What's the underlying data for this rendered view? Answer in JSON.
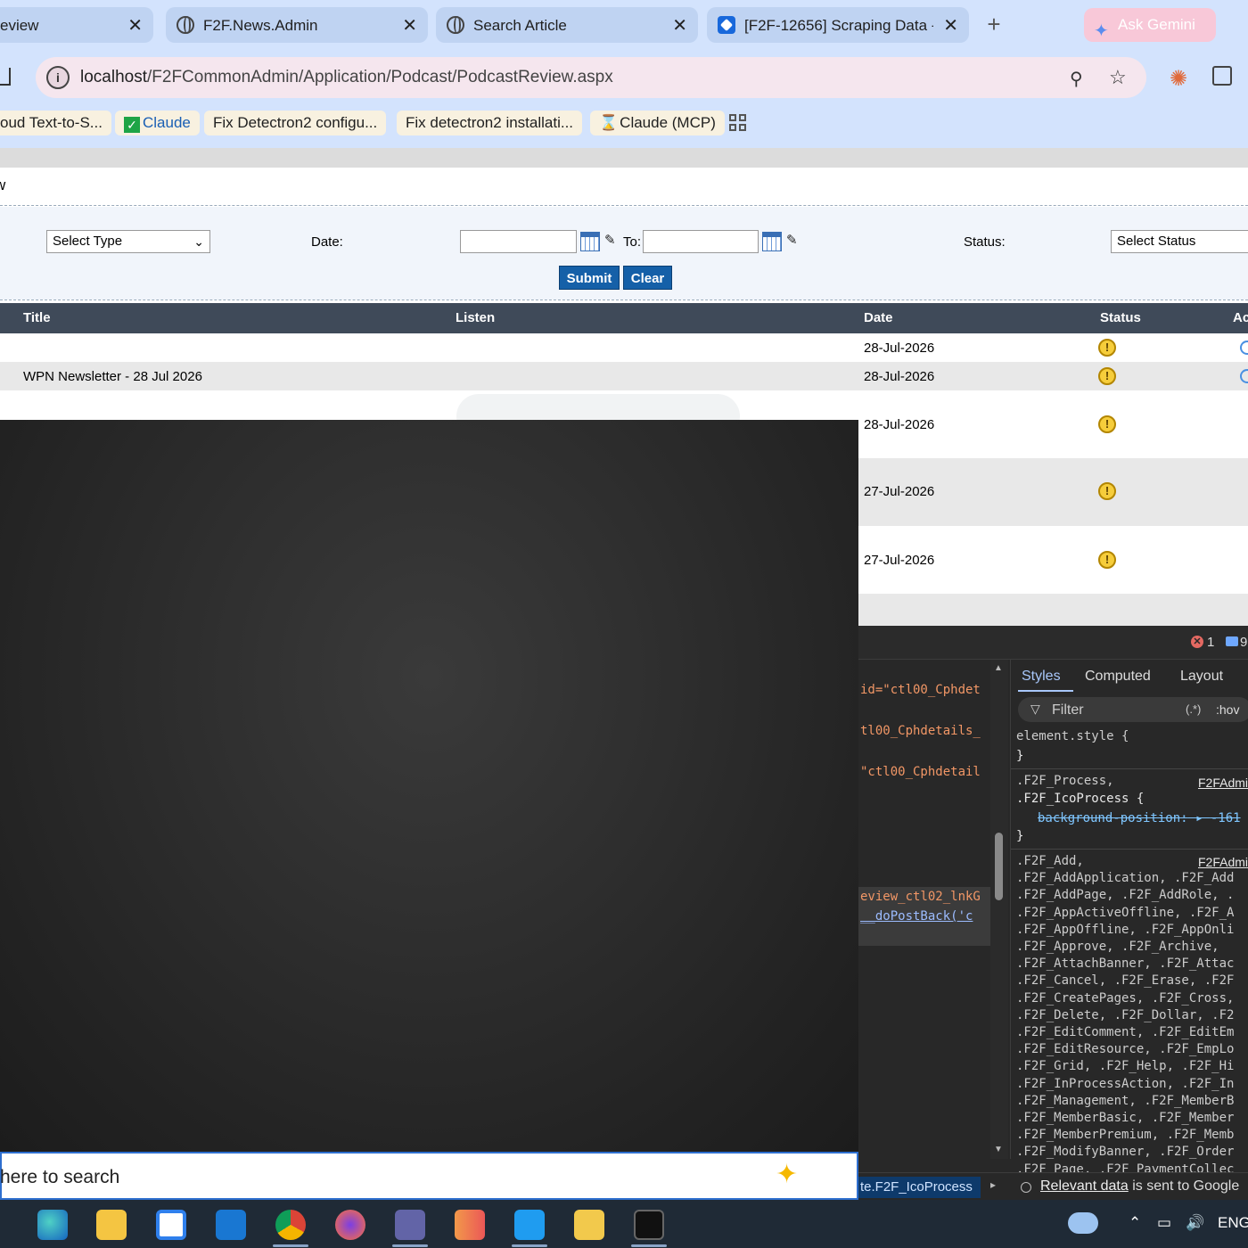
{
  "browser": {
    "tabs": [
      {
        "title": "eview"
      },
      {
        "title": "F2F.News.Admin"
      },
      {
        "title": "Search Article"
      },
      {
        "title": "[F2F-12656] Scraping Data -"
      }
    ],
    "ask_gemini": "Ask Gemini",
    "url_host": "localhost",
    "url_path": "/F2FCommonAdmin/Application/Podcast/PodcastReview.aspx",
    "bookmarks": [
      {
        "label": "oud Text-to-S..."
      },
      {
        "label": "Claude"
      },
      {
        "label": "Fix Detectron2 configu..."
      },
      {
        "label": "Fix detectron2 installati..."
      },
      {
        "label": "Claude (MCP)"
      }
    ]
  },
  "page": {
    "heading": "w",
    "filters": {
      "type_select": "Select Type",
      "date_label": "Date:",
      "to_label": "To:",
      "status_label": "Status:",
      "status_select": "Select Status",
      "submit": "Submit",
      "clear": "Clear"
    },
    "table": {
      "headers": {
        "title": "Title",
        "listen": "Listen",
        "date": "Date",
        "status": "Status",
        "actions": "Ac"
      },
      "rows": [
        {
          "title": "",
          "date": "28-Jul-2026"
        },
        {
          "title": "WPN Newsletter - 28 Jul 2026",
          "date": "28-Jul-2026"
        },
        {
          "title": "",
          "date": "28-Jul-2026"
        },
        {
          "title": "",
          "date": "27-Jul-2026"
        },
        {
          "title": "",
          "date": "27-Jul-2026"
        }
      ],
      "status_icon": "warning-icon"
    }
  },
  "devtools": {
    "error_count": "1",
    "message_count": "9",
    "dom_lines": [
      "id=\"ctl00_Cphdet",
      "tl00_Cphdetails_",
      "\"ctl00_Cphdetail",
      "eview_ctl02_lnkG",
      "__doPostBack('c"
    ],
    "tabs": {
      "styles": "Styles",
      "computed": "Computed",
      "layout": "Layout"
    },
    "filter_placeholder": "Filter",
    "filter_regex": "(.*)",
    "filter_hov": ":hov",
    "element_style": "element.style {",
    "close_brace": "}",
    "rule1": {
      "selector1": ".F2F_Process,",
      "selector2": ".F2F_IcoProcess {",
      "source": "F2FAdmi",
      "property": "background-position:",
      "value": "-161"
    },
    "rule2": {
      "source": "F2FAdmi",
      "selectors": [
        ".F2F_Add,",
        ".F2F_AddApplication, .F2F_Add",
        ".F2F_AddPage, .F2F_AddRole, .",
        ".F2F_AppActiveOffline, .F2F_A",
        ".F2F_AppOffline, .F2F_AppOnli",
        ".F2F_Approve, .F2F_Archive,",
        ".F2F_AttachBanner, .F2F_Attac",
        ".F2F_Cancel, .F2F_Erase, .F2F",
        ".F2F_CreatePages, .F2F_Cross,",
        ".F2F_Delete, .F2F_Dollar, .F2",
        ".F2F_EditComment, .F2F_EditEm",
        ".F2F_EditResource, .F2F_EmpLo",
        ".F2F_Grid, .F2F_Help, .F2F_Hi",
        ".F2F_InProcessAction, .F2F_In",
        ".F2F_Management, .F2F_MemberB",
        ".F2F_MemberBasic, .F2F_Member",
        ".F2F_MemberPremium, .F2F_Memb",
        ".F2F_ModifyBanner, .F2F_Order",
        ".F2F_Page, .F2F_PaymentCollec"
      ]
    },
    "breadcrumb": "te.F2F_IcoProcess",
    "relevant_link": "Relevant data",
    "relevant_rest": "is sent to Google"
  },
  "taskbar": {
    "search_text": "here to search",
    "lang": "ENG"
  },
  "colors": {
    "chrome_bg": "#d3e3fd",
    "table_header": "#3f4a59",
    "button": "#1560a8",
    "devtools_bg": "#282828"
  }
}
